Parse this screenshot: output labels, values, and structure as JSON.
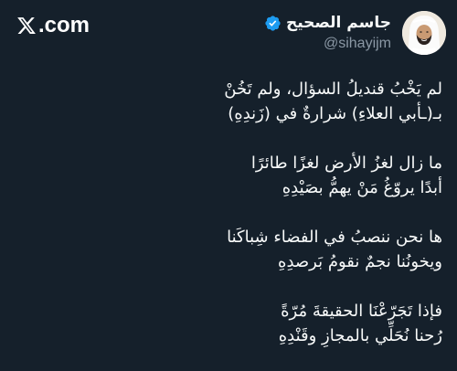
{
  "brand": {
    "text": ".com",
    "icon": "x-logo-icon"
  },
  "author": {
    "display_name": "جاسم الصحيح",
    "handle": "@sihayijm",
    "verified_icon": "verified-badge-icon",
    "avatar_icon": "profile-photo-avatar"
  },
  "tweet": {
    "stanzas": [
      {
        "lines": [
          "لم يَخْبُ قنديلُ السؤال، ولم تَخُنْ",
          "بـ(ـأبي العلاءِ) شرارةٌ في (زَندِهِ)"
        ]
      },
      {
        "lines": [
          "ما زال لغزُ الأرض لغزًا طائرًا",
          "أبدًا يروّغُ مَنْ يهمُّ بصَيْدِهِ"
        ]
      },
      {
        "lines": [
          "ها نحن ننصبُ في الفضاء شِباكَنا",
          "ويخونُنا نجمٌ نقومُ بَرصدِهِ"
        ]
      },
      {
        "lines": [
          "فإذا تَجَرّعْنَا الحقيقةَ مُرّةً",
          "رُحنا نُحَلِّي بالمجازِ وقَنْدِهِ"
        ]
      }
    ]
  },
  "colors": {
    "background": "#15202b",
    "text_primary": "#f7f9f9",
    "text_secondary": "#8b98a5",
    "verified_blue": "#1d9bf0"
  }
}
